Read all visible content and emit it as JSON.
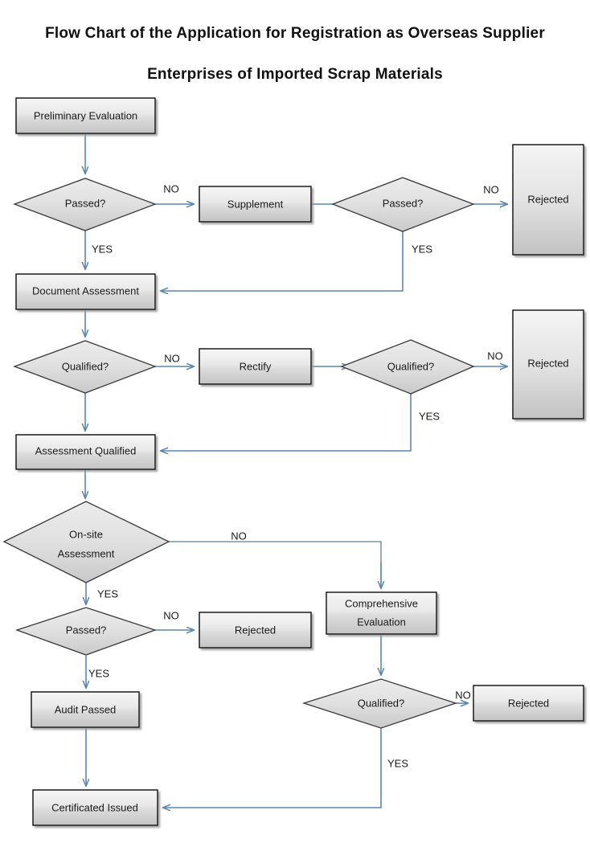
{
  "title": {
    "line1": "Flow Chart of the Application for Registration as Overseas Supplier",
    "line2": "Enterprises of Imported Scrap Materials"
  },
  "colors": {
    "connector": "#5b86b0",
    "shape_fill_light": "#f2f2f2",
    "shape_fill_dark": "#c6c6c6",
    "shape_border": "#0f0f0f",
    "text": "#1a1a1a",
    "background": "#ffffff"
  },
  "chart_data": {
    "type": "diagram",
    "title": "Flow Chart of the Application for Registration as Overseas Supplier Enterprises of Imported Scrap Materials",
    "nodes": [
      {
        "id": "preliminary_evaluation",
        "label": "Preliminary Evaluation",
        "shape": "process"
      },
      {
        "id": "passed_1",
        "label": "Passed?",
        "shape": "decision"
      },
      {
        "id": "supplement",
        "label": "Supplement",
        "shape": "process"
      },
      {
        "id": "passed_2",
        "label": "Passed?",
        "shape": "decision"
      },
      {
        "id": "rejected_1",
        "label": "Rejected",
        "shape": "process-tall"
      },
      {
        "id": "document_assessment",
        "label": "Document Assessment",
        "shape": "process"
      },
      {
        "id": "qualified_1",
        "label": "Qualified?",
        "shape": "decision"
      },
      {
        "id": "rectify",
        "label": "Rectify",
        "shape": "process"
      },
      {
        "id": "qualified_2",
        "label": "Qualified?",
        "shape": "decision"
      },
      {
        "id": "rejected_2",
        "label": "Rejected",
        "shape": "process-tall"
      },
      {
        "id": "assessment_qualified",
        "label": "Assessment Qualified",
        "shape": "process"
      },
      {
        "id": "onsite_assessment",
        "label": "On-site Assessment",
        "label_line1": "On-site",
        "label_line2": "Assessment",
        "shape": "decision-large"
      },
      {
        "id": "passed_3",
        "label": "Passed?",
        "shape": "decision"
      },
      {
        "id": "rejected_3",
        "label": "Rejected",
        "shape": "process"
      },
      {
        "id": "comprehensive_evaluation",
        "label": "Comprehensive Evaluation",
        "label_line1": "Comprehensive",
        "label_line2": "Evaluation",
        "shape": "process"
      },
      {
        "id": "qualified_3",
        "label": "Qualified?",
        "shape": "decision"
      },
      {
        "id": "rejected_4",
        "label": "Rejected",
        "shape": "process"
      },
      {
        "id": "audit_passed",
        "label": "Audit Passed",
        "shape": "process"
      },
      {
        "id": "certificated_issued",
        "label": "Certificated Issued",
        "shape": "process"
      }
    ],
    "edges": [
      {
        "from": "preliminary_evaluation",
        "to": "passed_1",
        "label": ""
      },
      {
        "from": "passed_1",
        "to": "supplement",
        "label": "NO"
      },
      {
        "from": "passed_1",
        "to": "document_assessment",
        "label": "YES"
      },
      {
        "from": "supplement",
        "to": "passed_2",
        "label": ""
      },
      {
        "from": "passed_2",
        "to": "rejected_1",
        "label": "NO"
      },
      {
        "from": "passed_2",
        "to": "document_assessment",
        "label": "YES"
      },
      {
        "from": "document_assessment",
        "to": "qualified_1",
        "label": ""
      },
      {
        "from": "qualified_1",
        "to": "rectify",
        "label": "NO"
      },
      {
        "from": "qualified_1",
        "to": "assessment_qualified",
        "label": ""
      },
      {
        "from": "rectify",
        "to": "qualified_2",
        "label": ""
      },
      {
        "from": "qualified_2",
        "to": "rejected_2",
        "label": "NO"
      },
      {
        "from": "qualified_2",
        "to": "assessment_qualified",
        "label": "YES"
      },
      {
        "from": "assessment_qualified",
        "to": "onsite_assessment",
        "label": ""
      },
      {
        "from": "onsite_assessment",
        "to": "comprehensive_evaluation",
        "label": "NO"
      },
      {
        "from": "onsite_assessment",
        "to": "passed_3",
        "label": "YES"
      },
      {
        "from": "passed_3",
        "to": "rejected_3",
        "label": "NO"
      },
      {
        "from": "passed_3",
        "to": "audit_passed",
        "label": "YES"
      },
      {
        "from": "comprehensive_evaluation",
        "to": "qualified_3",
        "label": ""
      },
      {
        "from": "qualified_3",
        "to": "rejected_4",
        "label": "NO"
      },
      {
        "from": "qualified_3",
        "to": "certificated_issued",
        "label": "YES"
      },
      {
        "from": "audit_passed",
        "to": "certificated_issued",
        "label": ""
      }
    ],
    "edge_labels": {
      "no_1": "NO",
      "yes_1": "YES",
      "no_2": "NO",
      "yes_2": "YES",
      "no_3": "NO",
      "yes_3": "YES",
      "no_4": "NO",
      "no_5": "NO",
      "yes_4": "YES",
      "no_6": "NO",
      "yes_5": "YES",
      "no_7": "NO",
      "yes_6": "YES"
    }
  }
}
